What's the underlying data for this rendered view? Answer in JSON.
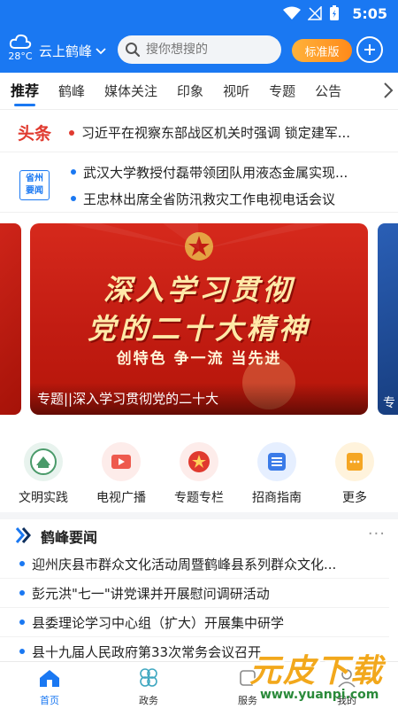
{
  "status_bar": {
    "time": "5:05"
  },
  "header": {
    "weather_temp": "28°C",
    "location": "云上鹤峰",
    "search_placeholder": "搜你想搜的",
    "edition_label": "标准版"
  },
  "tabs": [
    "推荐",
    "鹤峰",
    "媒体关注",
    "印象",
    "视听",
    "专题",
    "公告"
  ],
  "headline": {
    "tag": "头条",
    "text": "习近平在视察东部战区机关时强调 锁定建军..."
  },
  "provincial": {
    "badge_line1": "省州",
    "badge_line2": "要闻",
    "items": [
      "武汉大学教授付磊带领团队用液态金属实现...",
      "王忠林出席全省防汛救灾工作电视电话会议"
    ]
  },
  "banner": {
    "title_line1": "深入学习贯彻",
    "title_line2": "党的二十大精神",
    "subtitle": "创特色 争一流 当先进",
    "caption": "专题||深入学习贯彻党的二十大",
    "right_peek": "专"
  },
  "quick_links": [
    {
      "label": "文明实践",
      "icon": "civilization-practice-icon",
      "color": "#e8f3ee"
    },
    {
      "label": "电视广播",
      "icon": "tv-broadcast-icon",
      "color": "#fdecea"
    },
    {
      "label": "专题专栏",
      "icon": "special-topic-icon",
      "color": "#fdecea"
    },
    {
      "label": "招商指南",
      "icon": "investment-guide-icon",
      "color": "#e6efff"
    },
    {
      "label": "更多",
      "icon": "more-grid-icon",
      "color": "#fff3dc"
    }
  ],
  "section": {
    "title": "鹤峰要闻",
    "more": "···",
    "items": [
      "迎州庆县市群众文化活动周暨鹤峰县系列群众文化...",
      "彭元洪\"七一\"讲党课并开展慰问调研活动",
      "县委理论学习中心组（扩大）开展集中研学",
      "县十九届人民政府第33次常务会议召开"
    ]
  },
  "bottom_nav": [
    {
      "label": "首页",
      "icon": "home-icon"
    },
    {
      "label": "政务",
      "icon": "government-affairs-icon"
    },
    {
      "label": "服务",
      "icon": "service-icon"
    },
    {
      "label": "我的",
      "icon": "profile-icon"
    }
  ],
  "watermark": {
    "text": "元皮下载",
    "url": "www.yuanpi.com"
  },
  "colors": {
    "primary": "#1a78f2",
    "accent_red": "#e03a2f",
    "orange": "#ff8a1a"
  }
}
